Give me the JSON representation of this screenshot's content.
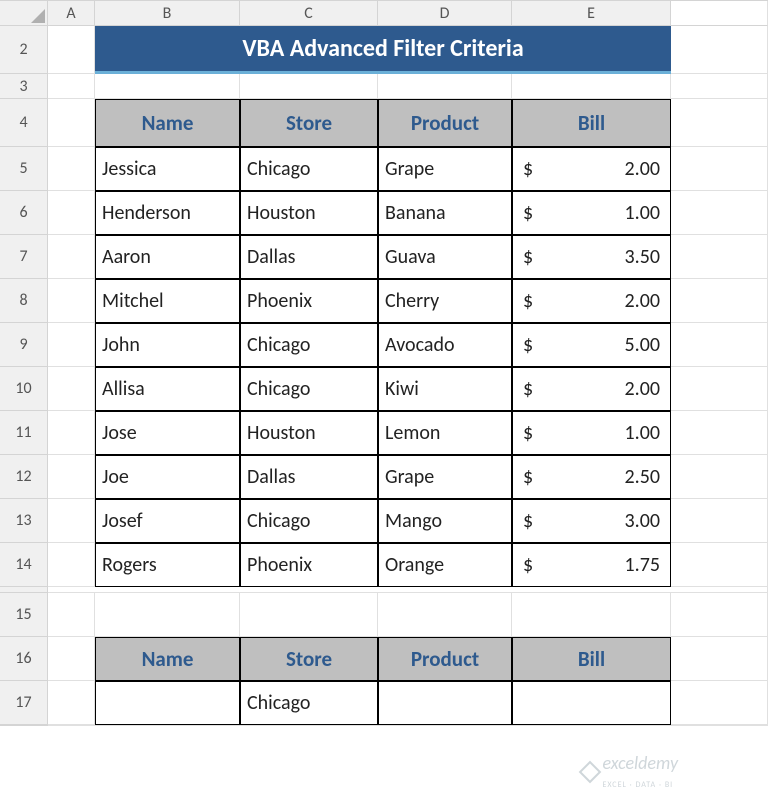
{
  "columns": [
    "A",
    "B",
    "C",
    "D",
    "E"
  ],
  "row_numbers": [
    2,
    3,
    4,
    5,
    6,
    7,
    8,
    9,
    10,
    11,
    12,
    13,
    14,
    15,
    16,
    17
  ],
  "title": "VBA Advanced Filter Criteria",
  "headers": {
    "name": "Name",
    "store": "Store",
    "product": "Product",
    "bill": "Bill"
  },
  "currency": "$",
  "data_rows": [
    {
      "name": "Jessica",
      "store": "Chicago",
      "product": "Grape",
      "bill": "2.00"
    },
    {
      "name": "Henderson",
      "store": "Houston",
      "product": "Banana",
      "bill": "1.00"
    },
    {
      "name": "Aaron",
      "store": "Dallas",
      "product": "Guava",
      "bill": "3.50"
    },
    {
      "name": "Mitchel",
      "store": "Phoenix",
      "product": "Cherry",
      "bill": "2.00"
    },
    {
      "name": "John",
      "store": "Chicago",
      "product": "Avocado",
      "bill": "5.00"
    },
    {
      "name": "Allisa",
      "store": "Chicago",
      "product": "Kiwi",
      "bill": "2.00"
    },
    {
      "name": "Jose",
      "store": "Houston",
      "product": "Lemon",
      "bill": "1.00"
    },
    {
      "name": "Joe",
      "store": "Dallas",
      "product": "Grape",
      "bill": "2.50"
    },
    {
      "name": "Josef",
      "store": "Chicago",
      "product": "Mango",
      "bill": "3.00"
    },
    {
      "name": "Rogers",
      "store": "Phoenix",
      "product": "Orange",
      "bill": "1.75"
    }
  ],
  "criteria_headers": {
    "name": "Name",
    "store": "Store",
    "product": "Product",
    "bill": "Bill"
  },
  "criteria_row": {
    "name": "",
    "store": "Chicago",
    "product": "",
    "bill": ""
  },
  "watermark": "exceldemy",
  "watermark_sub": "EXCEL · DATA · BI"
}
